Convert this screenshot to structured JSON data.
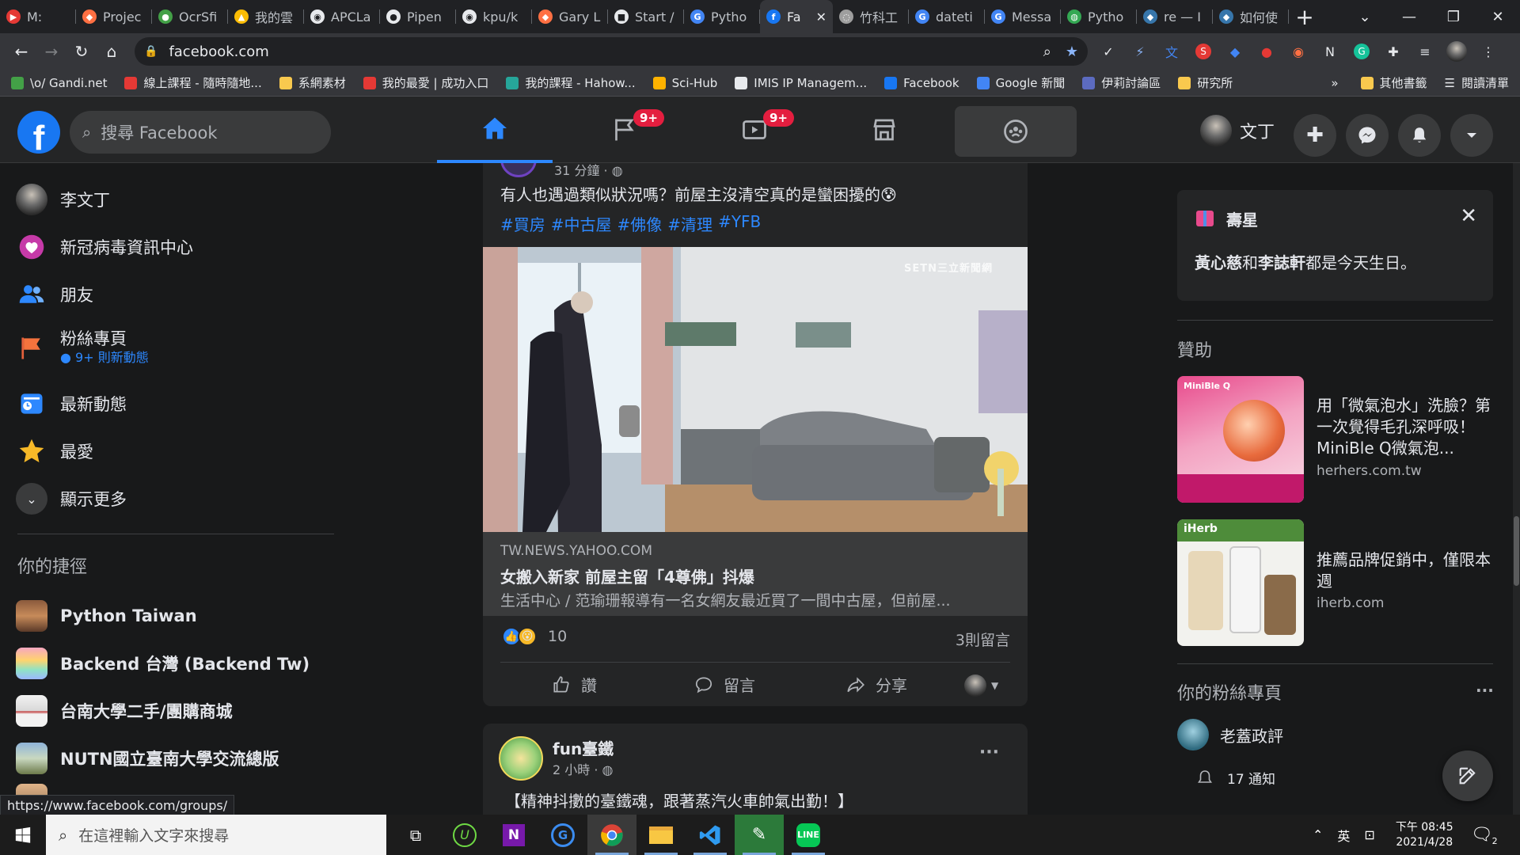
{
  "browser": {
    "tabs": [
      {
        "label": "M:",
        "color": "#e53935",
        "glyph": "▶"
      },
      {
        "label": "Projec",
        "color": "#ff7043",
        "glyph": "◆"
      },
      {
        "label": "OcrSfi",
        "color": "#43a047",
        "glyph": "●"
      },
      {
        "label": "我的雲",
        "color": "#fbbc04",
        "glyph": "▲"
      },
      {
        "label": "APCLa",
        "color": "#e8eaed",
        "glyph": "◉"
      },
      {
        "label": "Pipen",
        "color": "#e8eaed",
        "glyph": "●"
      },
      {
        "label": "kpu/k",
        "color": "#e8eaed",
        "glyph": "◉"
      },
      {
        "label": "Gary L",
        "color": "#ff7043",
        "glyph": "◆"
      },
      {
        "label": "Start /",
        "color": "#e8eaed",
        "glyph": "■"
      },
      {
        "label": "Pytho",
        "color": "#4285f4",
        "glyph": "G"
      },
      {
        "label": "Fa",
        "color": "#1877f2",
        "glyph": "f"
      },
      {
        "label": "竹科工",
        "color": "#9e9e9e",
        "glyph": "◌"
      },
      {
        "label": "dateti",
        "color": "#4285f4",
        "glyph": "G"
      },
      {
        "label": "Messa",
        "color": "#4285f4",
        "glyph": "G"
      },
      {
        "label": "Pytho",
        "color": "#34a853",
        "glyph": "◍"
      },
      {
        "label": "re — I",
        "color": "#3776ab",
        "glyph": "◆"
      },
      {
        "label": "如何使",
        "color": "#3776ab",
        "glyph": "◆"
      }
    ],
    "active_tab_index": 10,
    "url": "facebook.com",
    "bookmarks": [
      {
        "label": "\\o/ Gandi.net",
        "color": "#43a047"
      },
      {
        "label": "線上課程 - 隨時隨地...",
        "color": "#e53935"
      },
      {
        "label": "系網素材",
        "color": "#f9c94e"
      },
      {
        "label": "我的最愛 | 成功入口",
        "color": "#e53935"
      },
      {
        "label": "我的課程 - Hahow...",
        "color": "#26a69a"
      },
      {
        "label": "Sci-Hub",
        "color": "#ffb300"
      },
      {
        "label": "IMIS IP Managem...",
        "color": "#e8eaed"
      },
      {
        "label": "Facebook",
        "color": "#1877f2"
      },
      {
        "label": "Google 新聞",
        "color": "#4285f4"
      },
      {
        "label": "伊莉討論區",
        "color": "#5c6bc0"
      },
      {
        "label": "研究所",
        "color": "#f9c94e"
      }
    ],
    "bookmarks_more": "»",
    "other_bookmarks": "其他書籤",
    "reading_list": "閱讀清單"
  },
  "fb": {
    "search_placeholder": "搜尋 Facebook",
    "badges": {
      "pages": "9+",
      "watch": "9+"
    },
    "profile_name": "文丁"
  },
  "left": {
    "items": [
      {
        "label": "李文丁",
        "icon": "avatar-icon"
      },
      {
        "label": "新冠病毒資訊中心",
        "icon": "covid-info-icon"
      },
      {
        "label": "朋友",
        "icon": "friends-icon"
      },
      {
        "label": "粉絲專頁",
        "sub": "9+ 則新動態",
        "icon": "pages-flag-icon"
      },
      {
        "label": "最新動態",
        "icon": "most-recent-icon"
      },
      {
        "label": "最愛",
        "icon": "star-icon"
      },
      {
        "label": "顯示更多",
        "icon": "chevron-down-icon"
      }
    ],
    "shortcuts_title": "你的捷徑",
    "shortcuts": [
      {
        "label": "Python Taiwan"
      },
      {
        "label": "Backend 台灣 (Backend Tw)"
      },
      {
        "label": "台南大學二手/團購商城"
      },
      {
        "label": "NUTN國立臺南大學交流總版"
      }
    ]
  },
  "post1": {
    "meta_partial": "31 分鐘 · ",
    "text": "有人也遇過類似狀況嗎？前屋主沒清空真的是蠻困擾的😰",
    "hashtags": [
      "#買房",
      "#中古屋",
      "#佛像",
      "#清理",
      "#YFB"
    ],
    "image_watermark": "SETN三立新聞網",
    "link_domain": "TW.NEWS.YAHOO.COM",
    "link_title": "女搬入新家 前屋主留「4尊佛」抖爆",
    "link_desc": "生活中心 / 范瑜珊報導有一名女網友最近買了一間中古屋，但前屋...",
    "reaction_count": "10",
    "comment_count": "3則留言",
    "actions": {
      "like": "讚",
      "comment": "留言",
      "share": "分享"
    }
  },
  "post2": {
    "author": "fun臺鐵",
    "time": "2 小時 · ",
    "text": "【精神抖擻的臺鐵魂，跟著蒸汽火車帥氣出勤！】",
    "more": "···"
  },
  "right": {
    "birthday_title": "壽星",
    "birthday_name1": "黃心慈",
    "birthday_and": "和",
    "birthday_name2": "李誌軒",
    "birthday_suffix": "都是今天生日。",
    "sponsored_title": "贊助",
    "ads": [
      {
        "title": "用「微氣泡水」洗臉？第一次覺得毛孔深呼吸！MiniBle Q微氣泡...",
        "url": "herhers.com.tw",
        "img_brand": "MiniBle Q"
      },
      {
        "title": "推薦品牌促銷中，僅限本週",
        "url": "iherb.com",
        "img_brand": "iHerb"
      }
    ],
    "pages_title": "你的粉絲專頁",
    "pages_more": "···",
    "page_name": "老蓋政評",
    "notifications": "17 通知"
  },
  "status_link": "https://www.facebook.com/groups/",
  "taskbar": {
    "search_placeholder": "在這裡輸入文字來搜尋",
    "ime": "英",
    "time": "下午 08:45",
    "date": "2021/4/28",
    "notif_count": "2"
  }
}
